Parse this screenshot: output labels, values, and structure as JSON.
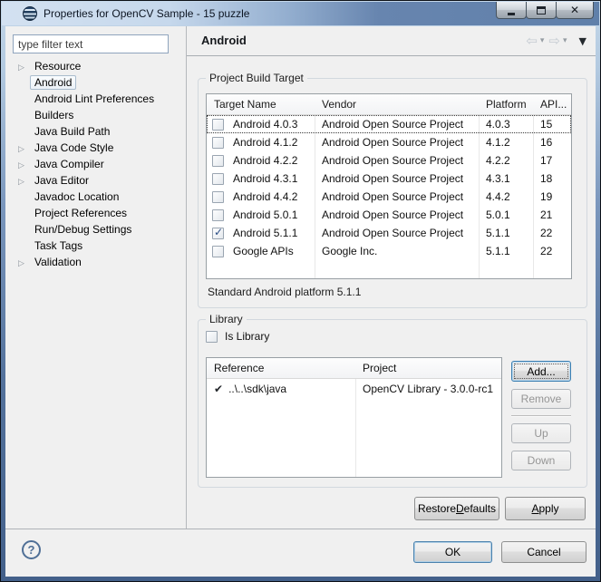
{
  "window": {
    "title": "Properties for OpenCV Sample - 15 puzzle",
    "controls": {
      "close_glyph": "✕"
    }
  },
  "icons": {
    "back": "⇦",
    "forward": "⇨",
    "caret": "▾",
    "view_menu": "▼",
    "twisty": "▷",
    "row_check": "✔",
    "help": "?"
  },
  "sidebar": {
    "filter_placeholder": "type filter text",
    "items": [
      {
        "label": "Resource",
        "expandable": true,
        "selected": false
      },
      {
        "label": "Android",
        "expandable": false,
        "selected": true
      },
      {
        "label": "Android Lint Preferences",
        "expandable": false,
        "selected": false
      },
      {
        "label": "Builders",
        "expandable": false,
        "selected": false
      },
      {
        "label": "Java Build Path",
        "expandable": false,
        "selected": false
      },
      {
        "label": "Java Code Style",
        "expandable": true,
        "selected": false
      },
      {
        "label": "Java Compiler",
        "expandable": true,
        "selected": false
      },
      {
        "label": "Java Editor",
        "expandable": true,
        "selected": false
      },
      {
        "label": "Javadoc Location",
        "expandable": false,
        "selected": false
      },
      {
        "label": "Project References",
        "expandable": false,
        "selected": false
      },
      {
        "label": "Run/Debug Settings",
        "expandable": false,
        "selected": false
      },
      {
        "label": "Task Tags",
        "expandable": false,
        "selected": false
      },
      {
        "label": "Validation",
        "expandable": true,
        "selected": false
      }
    ]
  },
  "header": {
    "title": "Android"
  },
  "build_target": {
    "group_label": "Project Build Target",
    "columns": [
      "Target Name",
      "Vendor",
      "Platform",
      "API..."
    ],
    "rows": [
      {
        "checked": false,
        "focused": true,
        "name": "Android 4.0.3",
        "vendor": "Android Open Source Project",
        "platform": "4.0.3",
        "api": "15"
      },
      {
        "checked": false,
        "focused": false,
        "name": "Android 4.1.2",
        "vendor": "Android Open Source Project",
        "platform": "4.1.2",
        "api": "16"
      },
      {
        "checked": false,
        "focused": false,
        "name": "Android 4.2.2",
        "vendor": "Android Open Source Project",
        "platform": "4.2.2",
        "api": "17"
      },
      {
        "checked": false,
        "focused": false,
        "name": "Android 4.3.1",
        "vendor": "Android Open Source Project",
        "platform": "4.3.1",
        "api": "18"
      },
      {
        "checked": false,
        "focused": false,
        "name": "Android 4.4.2",
        "vendor": "Android Open Source Project",
        "platform": "4.4.2",
        "api": "19"
      },
      {
        "checked": false,
        "focused": false,
        "name": "Android 5.0.1",
        "vendor": "Android Open Source Project",
        "platform": "5.0.1",
        "api": "21"
      },
      {
        "checked": true,
        "focused": false,
        "name": "Android 5.1.1",
        "vendor": "Android Open Source Project",
        "platform": "5.1.1",
        "api": "22"
      },
      {
        "checked": false,
        "focused": false,
        "name": "Google APIs",
        "vendor": "Google Inc.",
        "platform": "5.1.1",
        "api": "22"
      }
    ],
    "note": "Standard Android platform 5.1.1"
  },
  "library": {
    "group_label": "Library",
    "is_library_label": "Is Library",
    "is_library_checked": false,
    "columns": [
      "Reference",
      "Project"
    ],
    "rows": [
      {
        "reference": "..\\..\\sdk\\java",
        "project": "OpenCV Library - 3.0.0-rc1"
      }
    ],
    "buttons": {
      "add": "Add...",
      "remove": "Remove",
      "up": "Up",
      "down": "Down"
    }
  },
  "actions": {
    "restore_defaults": "Restore Defaults",
    "restore_defaults_mnemonic": "D",
    "apply": "Apply",
    "apply_mnemonic": "A",
    "ok": "OK",
    "cancel": "Cancel"
  },
  "colors": {
    "titlebar_blue": "#6383ad",
    "window_border_blue": "#4a6a94",
    "focus_blue": "#3c7fb1",
    "check_blue": "#2a4d85",
    "disabled_text": "#959595"
  }
}
